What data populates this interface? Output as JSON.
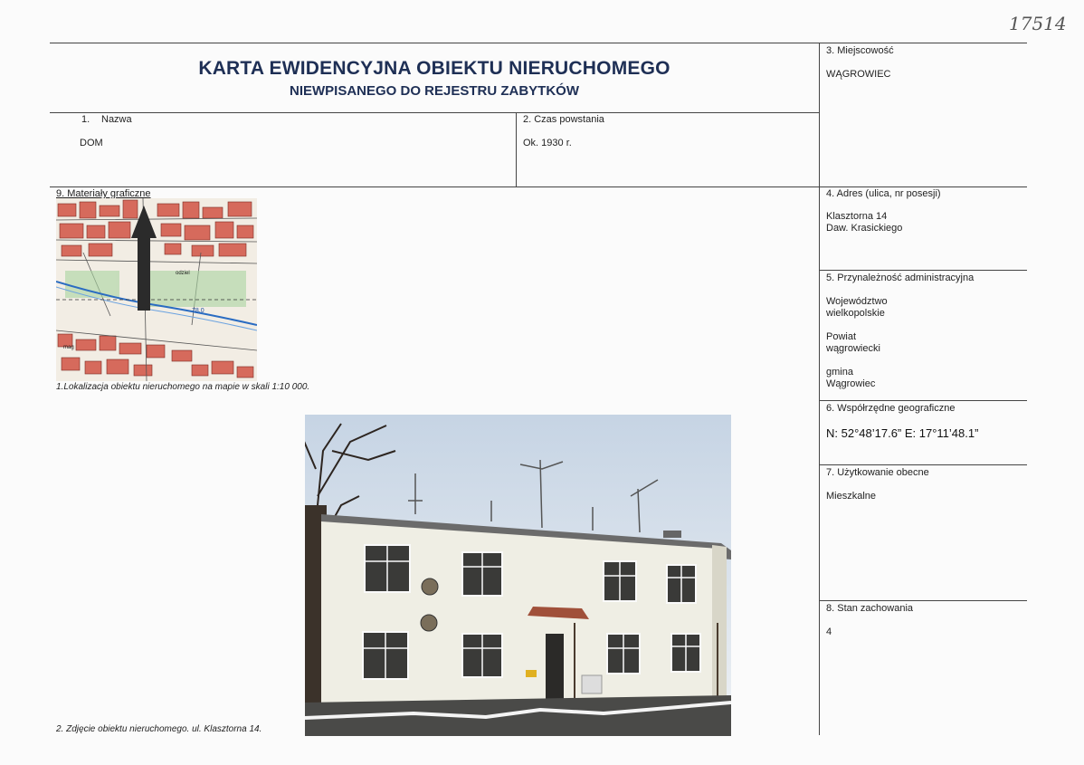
{
  "stamp": "17514",
  "header": {
    "title": "KARTA EWIDENCYJNA OBIEKTU NIERUCHOMEGO",
    "subtitle": "NIEWPISANEGO DO REJESTRU ZABYTKÓW"
  },
  "fields": {
    "miejscowosc": {
      "label": "3. Miejscowość",
      "value": "WĄGROWIEC"
    },
    "nazwa": {
      "label_num": "1.",
      "label": "Nazwa",
      "value": "DOM"
    },
    "czas": {
      "label": "2. Czas powstania",
      "value": "Ok. 1930 r."
    },
    "materialy": {
      "label": "9. Materiały graficzne"
    },
    "adres": {
      "label": "4. Adres (ulica, nr posesji)",
      "line1": "Klasztorna 14",
      "line2": "Daw. Krasickiego"
    },
    "admin": {
      "label": "5. Przynależność administracyjna",
      "woj_label": "Województwo",
      "woj_value": "wielkopolskie",
      "powiat_label": "Powiat",
      "powiat_value": "wągrowiecki",
      "gmina_label": "gmina",
      "gmina_value": "Wągrowiec"
    },
    "wspolrzedne": {
      "label": "6. Współrzędne geograficzne",
      "value": "N: 52°48’17.6”  E: 17°11’48.1”"
    },
    "uzytkowanie": {
      "label": "7. Użytkowanie obecne",
      "value": "Mieszkalne"
    },
    "stan": {
      "label": "8. Stan zachowania",
      "value": "4"
    }
  },
  "captions": {
    "map": "1.Lokalizacja obiektu nieruchomego na mapie w skali 1:10 000.",
    "photo": "2. Zdjęcie obiektu nieruchomego. ul. Klasztorna 14."
  },
  "map_labels": {
    "elevation": "78.0",
    "street1": "odziel",
    "street2": "mag"
  }
}
